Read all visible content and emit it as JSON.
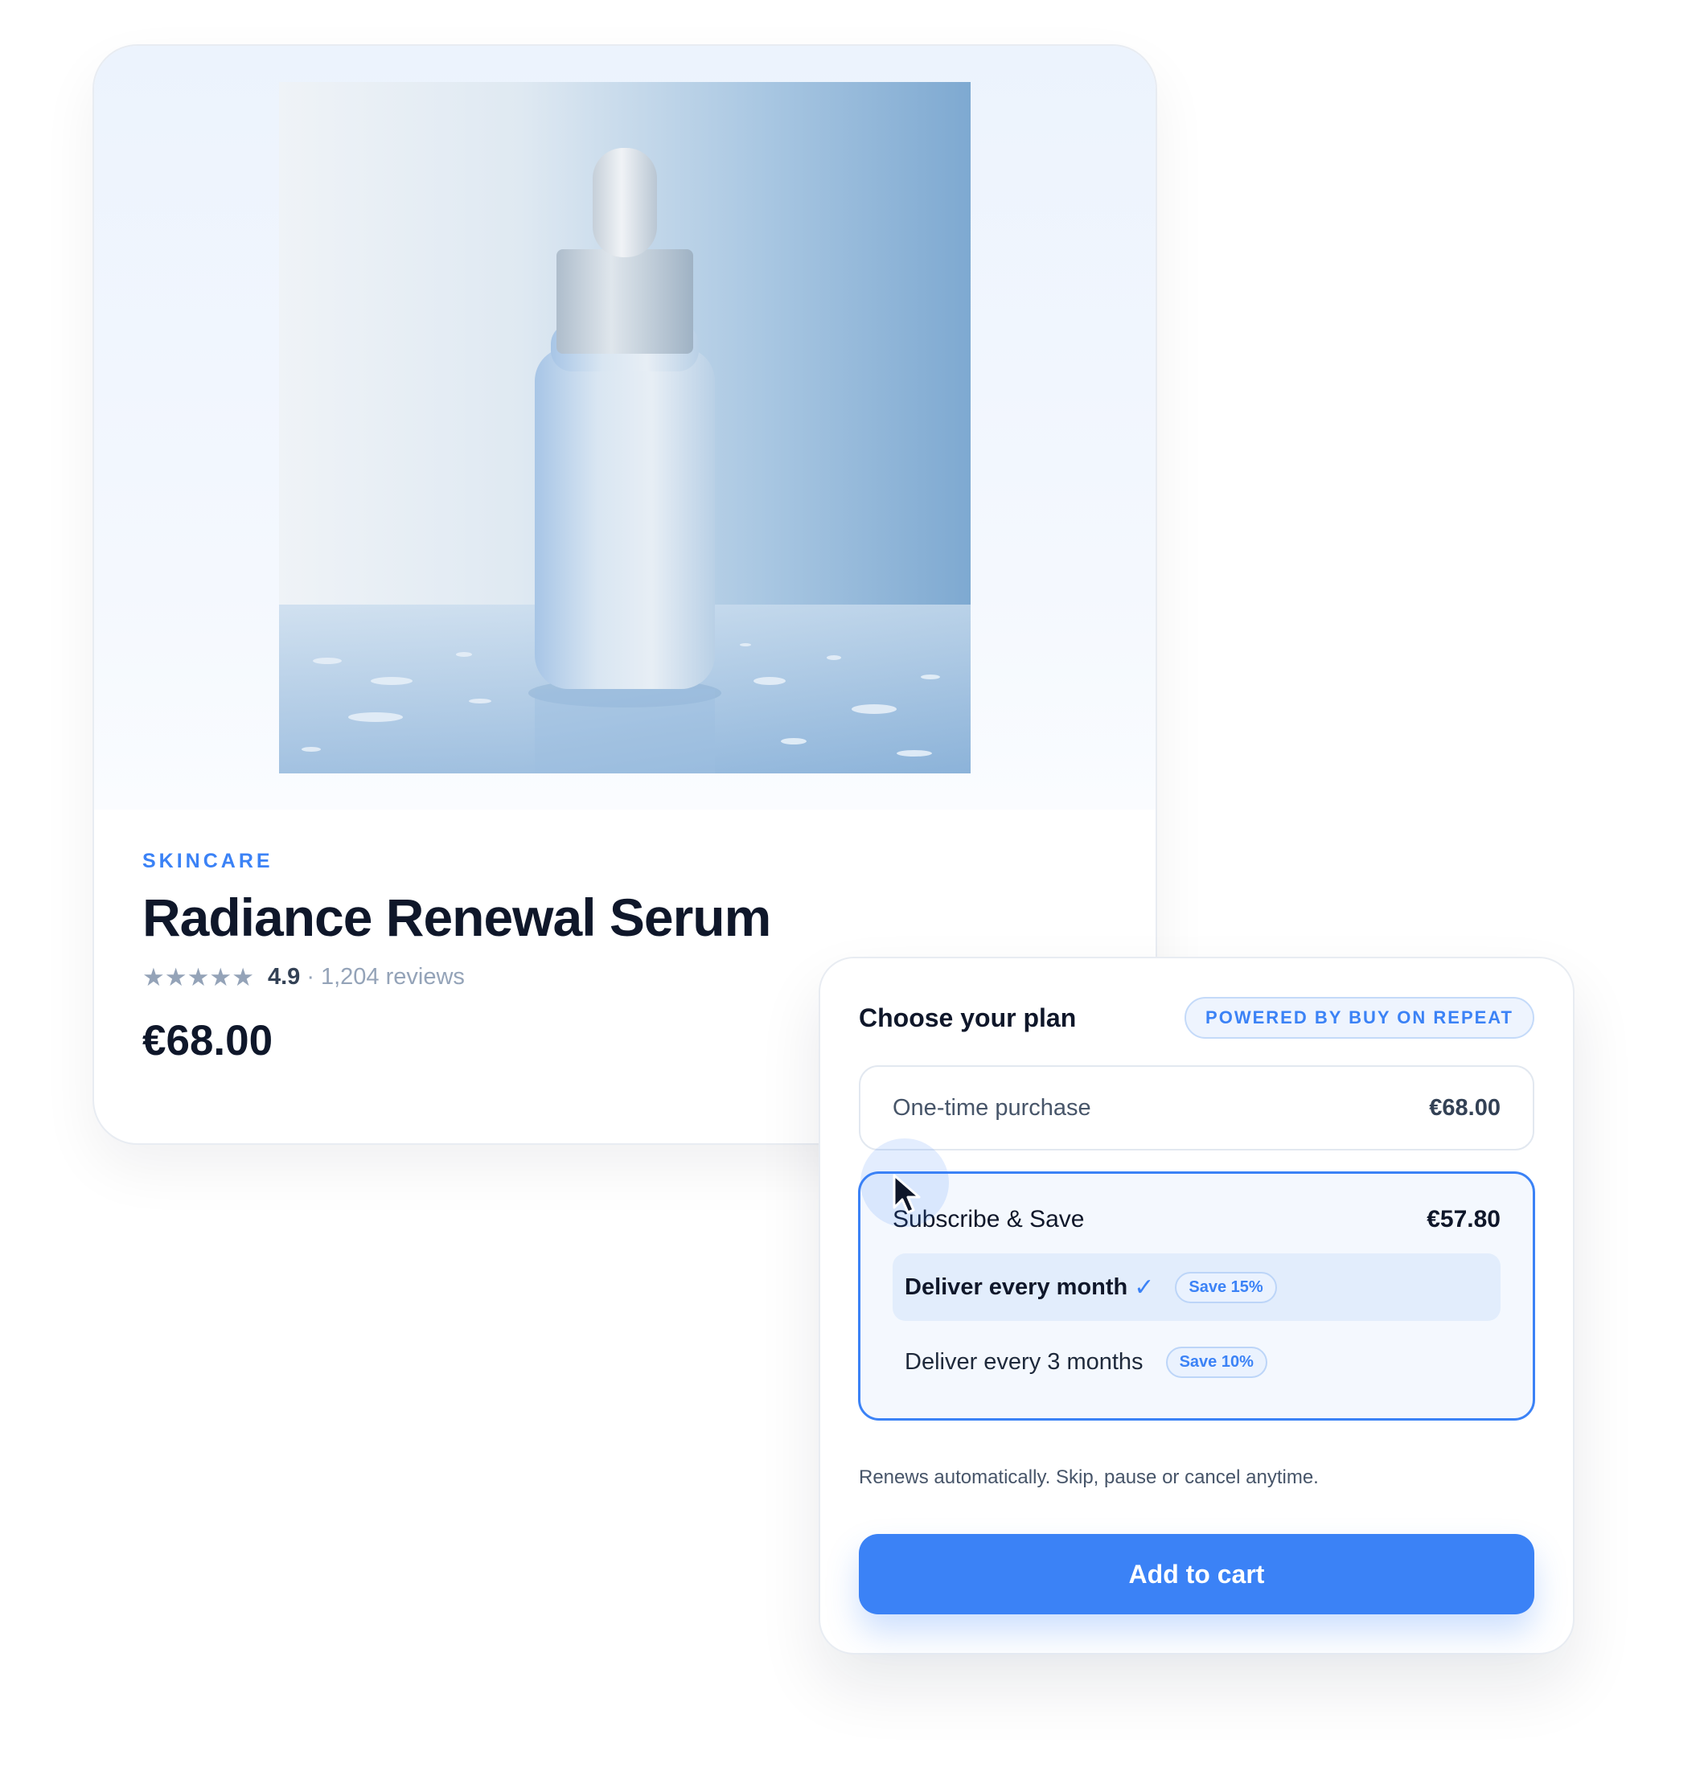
{
  "product": {
    "category": "SKINCARE",
    "title": "Radiance Renewal Serum",
    "rating_stars": 5,
    "rating_value": "4.9",
    "rating_separator": "·",
    "review_count": "1,204 reviews",
    "price": "€68.00",
    "image_icon": "serum-dropper-bottle"
  },
  "plan": {
    "heading": "Choose your plan",
    "powered_by": "POWERED BY BUY ON REPEAT",
    "one_time": {
      "label": "One-time purchase",
      "price": "€68.00"
    },
    "subscribe": {
      "label": "Subscribe & Save",
      "price": "€57.80",
      "frequencies": [
        {
          "label": "Deliver every month",
          "badge": "Save 15%",
          "selected": true,
          "icon": "check-icon"
        },
        {
          "label": "Deliver every 3 months",
          "badge": "Save 10%",
          "selected": false
        }
      ]
    },
    "note": "Renews automatically. Skip, pause or cancel anytime.",
    "cta": "Add to cart"
  },
  "colors": {
    "accent": "#3b82f6",
    "heading": "#0f172a",
    "muted": "#94a3b8"
  }
}
